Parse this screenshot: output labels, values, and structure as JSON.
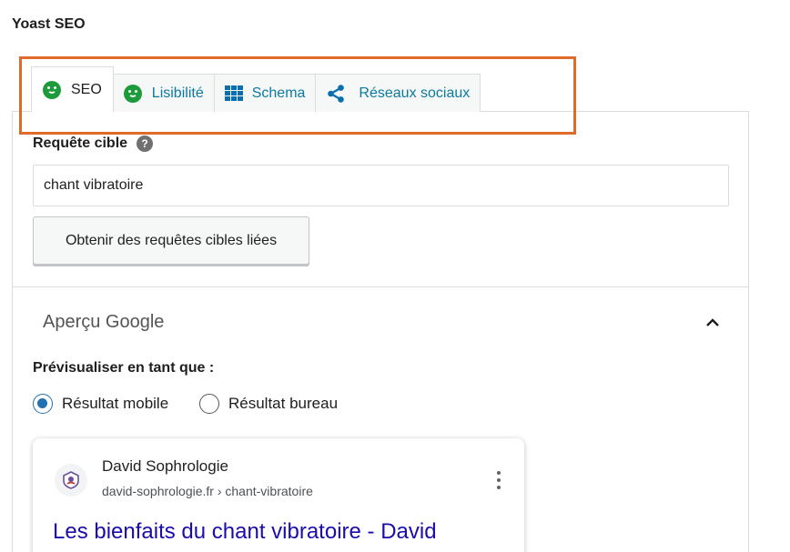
{
  "metabox": {
    "title": "Yoast SEO"
  },
  "tabs": [
    {
      "label": "SEO",
      "icon": "smiley-icon",
      "active": true
    },
    {
      "label": "Lisibilité",
      "icon": "smiley-icon",
      "active": false
    },
    {
      "label": "Schema",
      "icon": "grid-icon",
      "active": false
    },
    {
      "label": "Réseaux sociaux",
      "icon": "share-icon",
      "active": false
    }
  ],
  "focus_keyphrase": {
    "label": "Requête cible",
    "help_icon": "?",
    "value": "chant vibratoire",
    "related_button": "Obtenir des requêtes cibles liées"
  },
  "google_preview": {
    "title": "Aperçu Google",
    "preview_as_label": "Prévisualiser en tant que :",
    "options": [
      {
        "label": "Résultat mobile",
        "checked": true
      },
      {
        "label": "Résultat bureau",
        "checked": false
      }
    ],
    "card": {
      "site_name": "David Sophrologie",
      "url": "david-sophrologie.fr › chant-vibratoire",
      "title": "Les bienfaits du chant vibratoire - David"
    }
  },
  "colors": {
    "highlight": "#e06a2a",
    "good_score": "#1d9b3a",
    "link": "#1a0dab",
    "accent": "#2271b1"
  }
}
